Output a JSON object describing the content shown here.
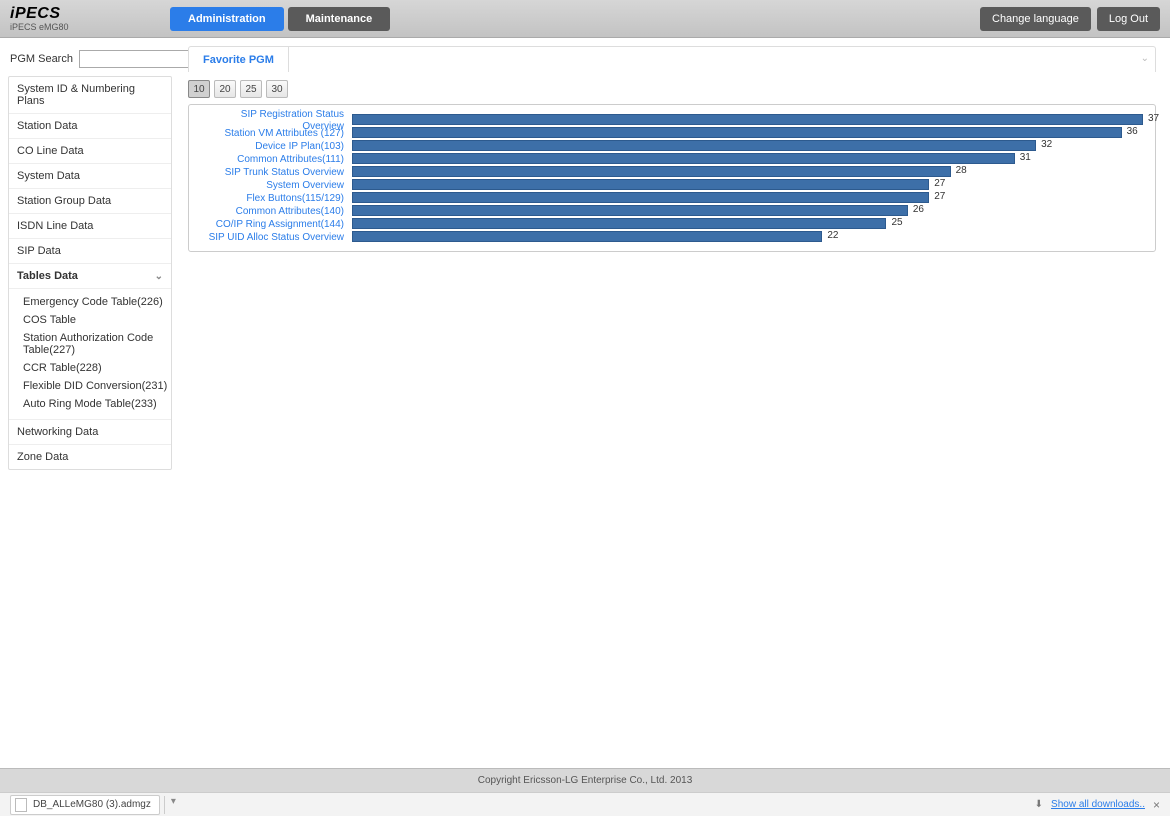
{
  "header": {
    "brand": "iPECS",
    "brand_sub": "iPECS eMG80",
    "nav": {
      "admin": "Administration",
      "maint": "Maintenance"
    },
    "change_lang": "Change language",
    "logout": "Log Out"
  },
  "sidebar": {
    "search_label": "PGM Search",
    "search_value": "",
    "items": [
      "System ID & Numbering Plans",
      "Station Data",
      "CO Line Data",
      "System Data",
      "Station Group Data",
      "ISDN Line Data",
      "SIP Data",
      "Tables Data",
      "Networking Data",
      "Zone Data"
    ],
    "tables_sub": [
      "Emergency Code Table(226)",
      "COS Table",
      "Station Authorization Code Table(227)",
      "CCR Table(228)",
      "Flexible DID Conversion(231)",
      "Auto Ring Mode Table(233)"
    ]
  },
  "tabs": {
    "favorite": "Favorite PGM"
  },
  "pager": {
    "opts": [
      "10",
      "20",
      "25",
      "30"
    ],
    "active": "10"
  },
  "chart_data": {
    "type": "bar",
    "orientation": "horizontal",
    "title": "",
    "xlabel": "",
    "ylabel": "",
    "xlim": [
      0,
      37
    ],
    "categories": [
      "SIP Registration Status Overview",
      "Station VM Attributes (127)",
      "Device IP Plan(103)",
      "Common Attributes(111)",
      "SIP Trunk Status Overview",
      "System Overview",
      "Flex Buttons(115/129)",
      "Common Attributes(140)",
      "CO/IP Ring Assignment(144)",
      "SIP UID Alloc Status Overview"
    ],
    "values": [
      37,
      36,
      32,
      31,
      28,
      27,
      27,
      26,
      25,
      22
    ]
  },
  "footer": {
    "copyright": "Copyright Ericsson-LG Enterprise Co., Ltd. 2013"
  },
  "download": {
    "file": "DB_ALLeMG80 (3).admgz",
    "show_all": "Show all downloads.."
  }
}
